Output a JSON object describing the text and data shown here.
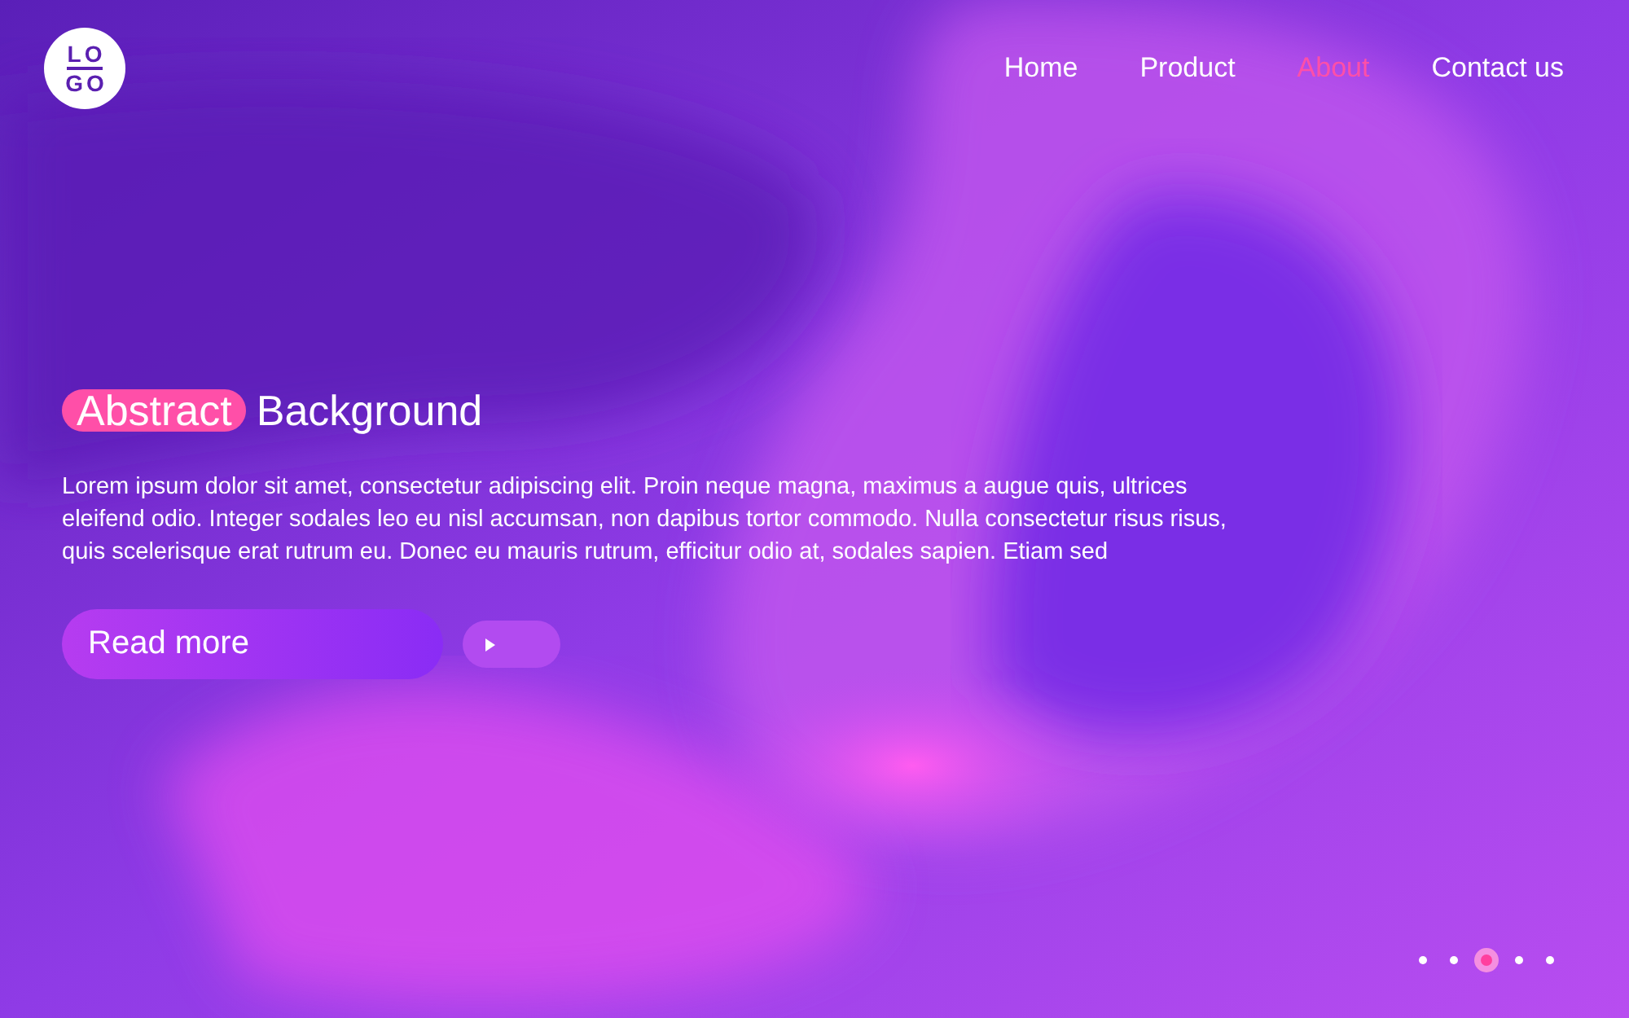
{
  "logo": {
    "lines": [
      "LO",
      "GO"
    ]
  },
  "nav": [
    {
      "label": "Home",
      "selected": false
    },
    {
      "label": "Product",
      "selected": false
    },
    {
      "label": "About",
      "selected": true
    },
    {
      "label": "Contact us",
      "selected": false
    }
  ],
  "hero": {
    "highlight": "Abstract",
    "title": "Background",
    "body": "Lorem ipsum dolor sit amet, consectetur adipiscing elit. Proin neque magna, maximus a augue quis, ultrices eleifend odio. Integer sodales leo eu nisl accumsan, non dapibus tortor commodo. Nulla consectetur risus risus, quis scelerisque erat rutrum eu. Donec eu mauris rutrum, efficitur odio at, sodales sapien. Etiam sed",
    "button": "Read more"
  },
  "pager": [
    {
      "selected": false
    },
    {
      "selected": false
    },
    {
      "selected": true
    },
    {
      "selected": false
    },
    {
      "selected": false
    }
  ]
}
